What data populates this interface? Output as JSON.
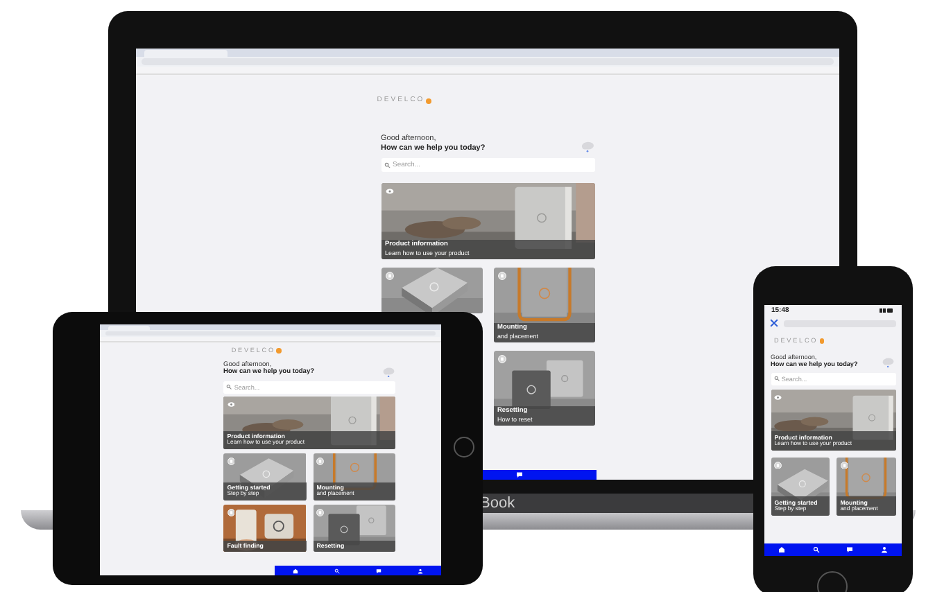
{
  "laptop": {
    "brand": "Book",
    "screen": {
      "logo": "DEVELCO",
      "greeting": "Good afternoon,",
      "question": "How can we help you today?",
      "search": {
        "placeholder": "Search..."
      },
      "cards": [
        {
          "kind": "hero",
          "title": "Product information",
          "subtitle": "Learn how to use your product"
        },
        {
          "kind": "tile"
        },
        {
          "kind": "tile",
          "title": "Mounting",
          "subtitle": "and placement"
        },
        {
          "kind": "tile",
          "title": "Resetting",
          "subtitle": "How to reset"
        }
      ]
    }
  },
  "tablet": {
    "screen": {
      "logo": "DEVELCO",
      "greeting": "Good afternoon,",
      "question": "How can we help you today?",
      "search": {
        "placeholder": "Search..."
      },
      "cards": [
        {
          "kind": "hero",
          "title": "Product information",
          "subtitle": "Learn how to use your product"
        },
        {
          "kind": "tile",
          "title": "Getting started",
          "subtitle": "Step by step"
        },
        {
          "kind": "tile",
          "title": "Mounting",
          "subtitle": "and placement"
        },
        {
          "kind": "tile",
          "title": "Fault finding"
        },
        {
          "kind": "tile",
          "title": "Resetting"
        }
      ]
    }
  },
  "phone": {
    "time": "15:48",
    "screen": {
      "logo": "DEVELCO",
      "greeting": "Good afternoon,",
      "question": "How can we help you today?",
      "search": {
        "placeholder": "Search..."
      },
      "cards": [
        {
          "kind": "hero",
          "title": "Product information",
          "subtitle": "Learn how to use your product"
        },
        {
          "kind": "tile",
          "title": "Getting started",
          "subtitle": "Step by step"
        },
        {
          "kind": "tile",
          "title": "Mounting",
          "subtitle": "and placement"
        }
      ]
    }
  }
}
